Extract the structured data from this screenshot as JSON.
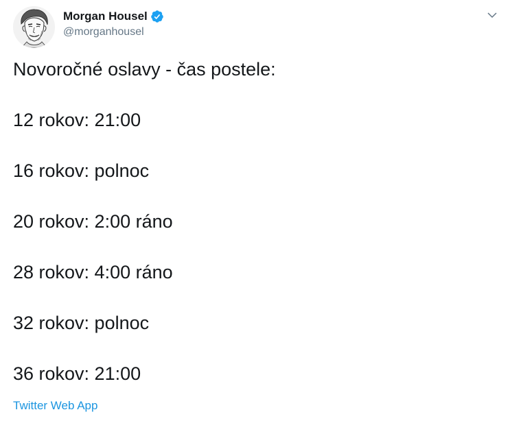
{
  "author": {
    "display_name": "Morgan Housel",
    "handle": "@morganhousel",
    "verified": true,
    "verified_color": "#1da1f2",
    "avatar_icon": "portrait-sketch-avatar"
  },
  "tweet": {
    "title": "Novoročné oslavy - čas postele:",
    "entries": [
      "12 rokov: 21:00",
      "16 rokov: polnoc",
      "20 rokov: 2:00 ráno",
      "28 rokov: 4:00 ráno",
      "32 rokov: polnoc",
      "36 rokov: 21:00"
    ]
  },
  "source": {
    "label": "Twitter Web App",
    "color": "#1b95e0"
  },
  "menu": {
    "icon": "chevron-down-icon"
  }
}
